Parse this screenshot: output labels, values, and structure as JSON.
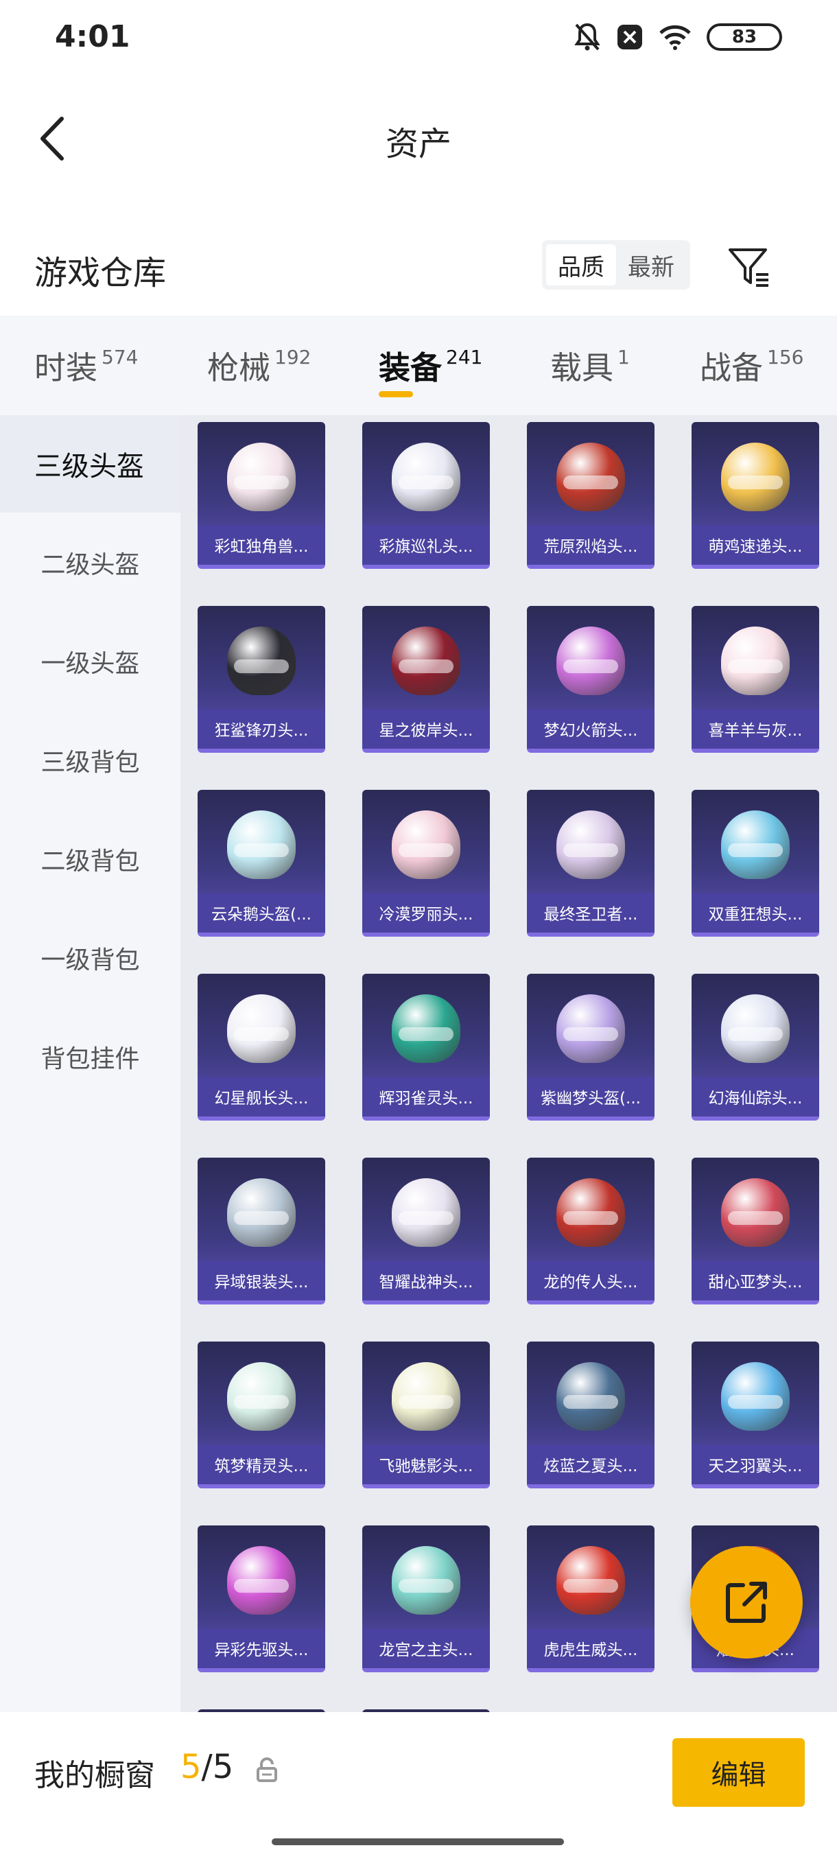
{
  "status_bar": {
    "time": "4:01",
    "battery": "83",
    "icons": [
      "bell-off-icon",
      "notification-x-icon",
      "wifi-icon",
      "battery-icon"
    ]
  },
  "header": {
    "back_icon": "chevron-left-icon",
    "title": "资产"
  },
  "section": {
    "title": "游戏仓库",
    "sort_options": [
      "品质",
      "最新"
    ],
    "sort_selected": "品质",
    "filter_icon": "filter-icon"
  },
  "tabs": [
    {
      "label": "时装",
      "count": "574"
    },
    {
      "label": "枪械",
      "count": "192"
    },
    {
      "label": "装备",
      "count": "241"
    },
    {
      "label": "载具",
      "count": "1"
    },
    {
      "label": "战备",
      "count": "156"
    }
  ],
  "active_tab": "装备",
  "sidebar": {
    "items": [
      "三级头盔",
      "二级头盔",
      "一级头盔",
      "三级背包",
      "二级背包",
      "一级背包",
      "背包挂件"
    ],
    "selected": "三级头盔"
  },
  "items": [
    {
      "name": "彩虹独角兽...",
      "color": "#f3e3ea"
    },
    {
      "name": "彩旗巡礼头...",
      "color": "#e8e8f4"
    },
    {
      "name": "荒原烈焰头...",
      "color": "#c0392b"
    },
    {
      "name": "萌鸡速递头...",
      "color": "#f2c14e"
    },
    {
      "name": "狂鲨锋刃头...",
      "color": "#2b2b33"
    },
    {
      "name": "星之彼岸头...",
      "color": "#8e1f2f"
    },
    {
      "name": "梦幻火箭头...",
      "color": "#c86fd8"
    },
    {
      "name": "喜羊羊与灰...",
      "color": "#f7dfe6"
    },
    {
      "name": "云朵鹅头盔(...",
      "color": "#bfe6ef"
    },
    {
      "name": "冷漠罗丽头...",
      "color": "#f1c9d6"
    },
    {
      "name": "最终圣卫者...",
      "color": "#d9c8e8"
    },
    {
      "name": "双重狂想头...",
      "color": "#6fc6e6"
    },
    {
      "name": "幻星舰长头...",
      "color": "#eeeef6"
    },
    {
      "name": "辉羽雀灵头...",
      "color": "#2aa68f"
    },
    {
      "name": "紫幽梦头盔(...",
      "color": "#b8a2e6"
    },
    {
      "name": "幻海仙踪头...",
      "color": "#dfe3f2"
    },
    {
      "name": "异域银装头...",
      "color": "#b7c6d4"
    },
    {
      "name": "智耀战神头...",
      "color": "#e7e2f0"
    },
    {
      "name": "龙的传人头...",
      "color": "#c0342c"
    },
    {
      "name": "甜心亚梦头...",
      "color": "#d24a5a"
    },
    {
      "name": "筑梦精灵头...",
      "color": "#d6eee6"
    },
    {
      "name": "飞驰魅影头...",
      "color": "#eeeed0"
    },
    {
      "name": "炫蓝之夏头...",
      "color": "#4b6f93"
    },
    {
      "name": "天之羽翼头...",
      "color": "#5fb5e8"
    },
    {
      "name": "异彩先驱头...",
      "color": "#d35ad6"
    },
    {
      "name": "龙宫之主头...",
      "color": "#7ed3c9"
    },
    {
      "name": "虎虎生威头...",
      "color": "#d8362b"
    },
    {
      "name": "焰龙天头...",
      "color": "#c0392b"
    }
  ],
  "fab_icon": "share-icon",
  "bottom": {
    "label": "我的橱窗",
    "current": "5",
    "separator": "/",
    "max": "5",
    "lock_icon": "lock-icon",
    "edit_label": "编辑"
  },
  "accent_color": "#f6b100"
}
